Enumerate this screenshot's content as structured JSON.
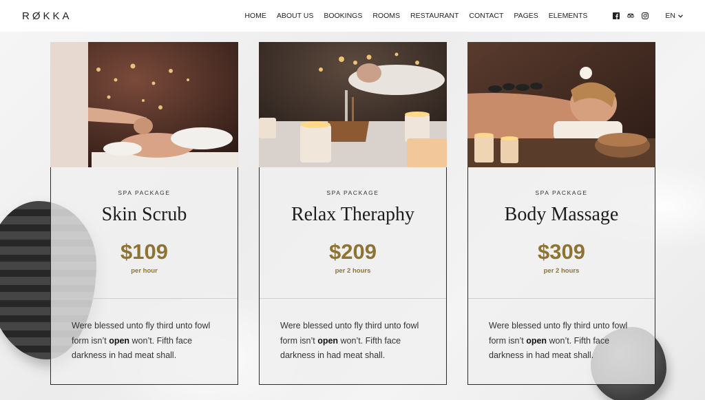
{
  "brand": {
    "logo": "RØKKA"
  },
  "nav": {
    "items": [
      "HOME",
      "ABOUT US",
      "BOOKINGS",
      "ROOMS",
      "RESTAURANT",
      "CONTACT",
      "PAGES",
      "ELEMENTS"
    ],
    "social": [
      "facebook-icon",
      "tripadvisor-icon",
      "instagram-icon"
    ],
    "language": "EN"
  },
  "cards": [
    {
      "eyebrow": "SPA PACKAGE",
      "title": "Skin Scrub",
      "price": "$109",
      "unit": "per hour",
      "desc_1": "Were blessed unto fly third unto fowl form isn’t ",
      "desc_bold": "open",
      "desc_2": " won’t. Fifth face darkness in had meat shall."
    },
    {
      "eyebrow": "SPA PACKAGE",
      "title": "Relax Theraphy",
      "price": "$209",
      "unit": "per 2 hours",
      "desc_1": "Were blessed unto fly third unto fowl form isn’t ",
      "desc_bold": "open",
      "desc_2": " won’t. Fifth face darkness in had meat shall."
    },
    {
      "eyebrow": "SPA PACKAGE",
      "title": "Body Massage",
      "price": "$309",
      "unit": "per 2 hours",
      "desc_1": "Were blessed unto fly third unto fowl form isn’t ",
      "desc_bold": "open",
      "desc_2": " won’t. Fifth face darkness in had meat shall."
    }
  ],
  "colors": {
    "accent": "#8f7330",
    "border": "#2a2a2a",
    "header_bg": "#ffffff"
  }
}
